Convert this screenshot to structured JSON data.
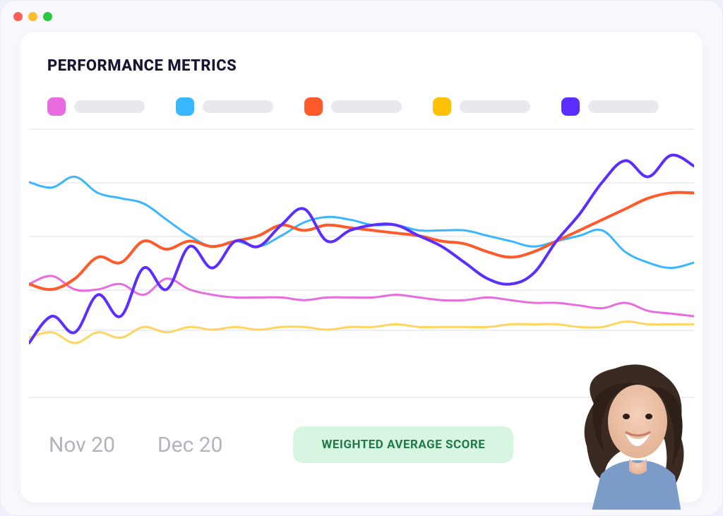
{
  "title": "PERFORMANCE METRICS",
  "legend": {
    "colors": [
      "#E86BDF",
      "#38B6FF",
      "#FF5A29",
      "#FFC107",
      "#5B2EFF"
    ]
  },
  "xaxis": [
    "Nov 20",
    "Dec 20"
  ],
  "badge": "WEIGHTED AVERAGE SCORE",
  "chart_data": {
    "type": "line",
    "title": "PERFORMANCE METRICS",
    "xlabel": "",
    "ylabel": "",
    "categories": [
      "Nov 20",
      "Dec 20"
    ],
    "ylim": [
      0,
      100
    ],
    "series": [
      {
        "name": "Pink",
        "color": "#E86BDF",
        "values": [
          42,
          45,
          40,
          40,
          42,
          38,
          44,
          40,
          38,
          37,
          37,
          37,
          36,
          37,
          37,
          37,
          38,
          37,
          36,
          36,
          37,
          36,
          35,
          35,
          34,
          33,
          35,
          32,
          31,
          30
        ]
      },
      {
        "name": "Blue",
        "color": "#38B6FF",
        "values": [
          80,
          78,
          82,
          76,
          74,
          72,
          66,
          60,
          56,
          58,
          56,
          60,
          65,
          67,
          66,
          64,
          64,
          62,
          62,
          62,
          60,
          58,
          56,
          58,
          60,
          62,
          54,
          50,
          48,
          50
        ]
      },
      {
        "name": "Orange",
        "color": "#FF5A29",
        "values": [
          42,
          40,
          44,
          52,
          50,
          58,
          55,
          58,
          56,
          58,
          60,
          64,
          62,
          64,
          63,
          62,
          61,
          60,
          58,
          57,
          54,
          52,
          54,
          58,
          62,
          66,
          70,
          74,
          76,
          76
        ]
      },
      {
        "name": "Yellow",
        "color": "#FFD560",
        "values": [
          22,
          24,
          20,
          24,
          22,
          26,
          24,
          26,
          25,
          26,
          25,
          26,
          26,
          25,
          26,
          26,
          27,
          26,
          26,
          26,
          26,
          27,
          27,
          27,
          26,
          26,
          28,
          27,
          27,
          27
        ]
      },
      {
        "name": "Indigo",
        "color": "#5B2EFF",
        "values": [
          20,
          30,
          24,
          38,
          30,
          48,
          40,
          56,
          48,
          58,
          56,
          64,
          70,
          58,
          62,
          64,
          64,
          60,
          56,
          50,
          44,
          42,
          46,
          58,
          68,
          80,
          88,
          82,
          90,
          86
        ]
      }
    ]
  }
}
